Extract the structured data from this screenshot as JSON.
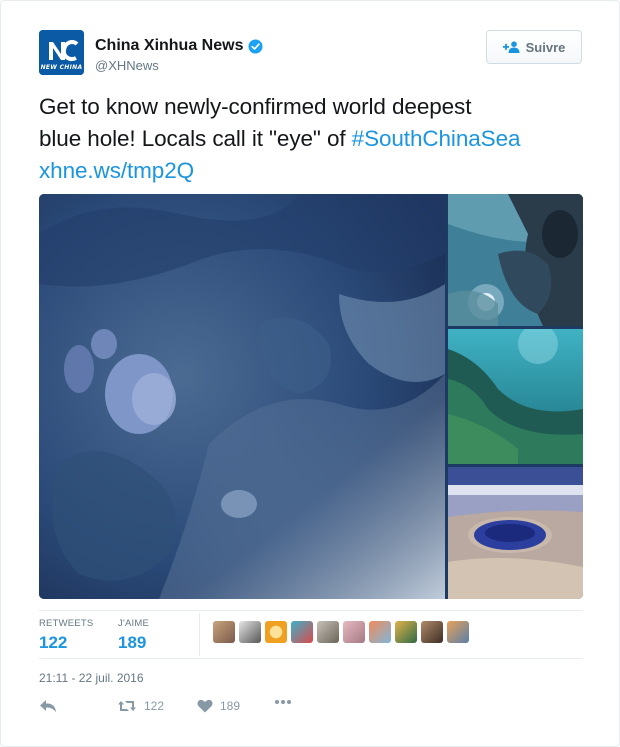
{
  "account": {
    "display_name": "China Xinhua News",
    "handle": "@XHNews",
    "avatar_text": "NEW CHINA",
    "verified": true
  },
  "follow_button": {
    "label": "Suivre",
    "icon": "add-user-icon"
  },
  "tweet": {
    "line1": "Get to know newly-confirmed world deepest",
    "line2_prefix": "blue hole! Locals call it \"eye\" of ",
    "hashtag": "#SouthChinaSea",
    "link": "xhne.ws/tmp2Q"
  },
  "media": {
    "photos": [
      "coral-reef-closeup",
      "diver-with-light",
      "underwater-reef-slope",
      "blue-hole-aerial"
    ]
  },
  "stats": {
    "retweets_label": "RETWEETS",
    "retweets_value": "122",
    "likes_label": "J'AIME",
    "likes_value": "189"
  },
  "likers": {
    "count_shown": 10
  },
  "timestamp": "21:11 - 22 juil. 2016",
  "actions": {
    "reply_icon": "reply-icon",
    "retweet_count": "122",
    "like_count": "189",
    "more_icon": "more-icon"
  },
  "colors": {
    "link_blue": "#1b95e0",
    "text": "#14171a",
    "muted": "#657786",
    "verified_blue": "#1da1f2"
  }
}
